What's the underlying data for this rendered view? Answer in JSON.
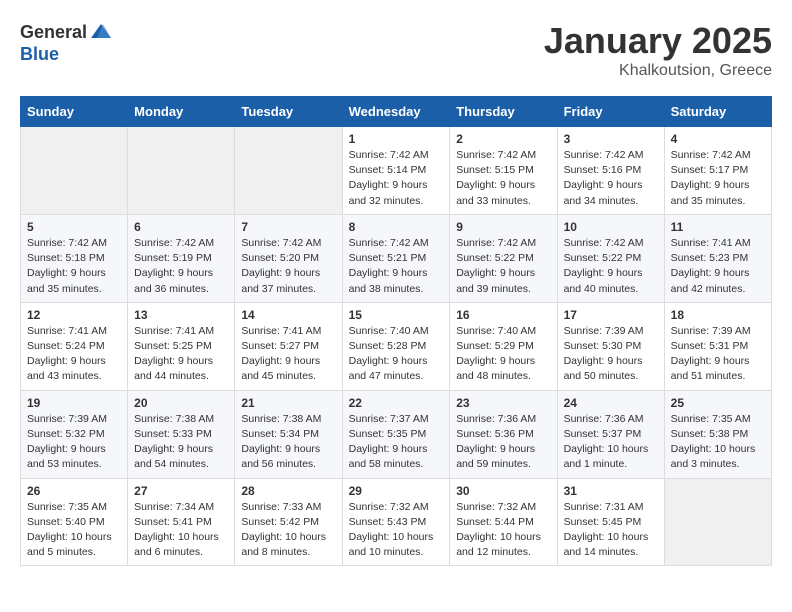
{
  "header": {
    "logo_general": "General",
    "logo_blue": "Blue",
    "month": "January 2025",
    "location": "Khalkoutsion, Greece"
  },
  "weekdays": [
    "Sunday",
    "Monday",
    "Tuesday",
    "Wednesday",
    "Thursday",
    "Friday",
    "Saturday"
  ],
  "weeks": [
    [
      {
        "day": "",
        "info": ""
      },
      {
        "day": "",
        "info": ""
      },
      {
        "day": "",
        "info": ""
      },
      {
        "day": "1",
        "info": "Sunrise: 7:42 AM\nSunset: 5:14 PM\nDaylight: 9 hours and 32 minutes."
      },
      {
        "day": "2",
        "info": "Sunrise: 7:42 AM\nSunset: 5:15 PM\nDaylight: 9 hours and 33 minutes."
      },
      {
        "day": "3",
        "info": "Sunrise: 7:42 AM\nSunset: 5:16 PM\nDaylight: 9 hours and 34 minutes."
      },
      {
        "day": "4",
        "info": "Sunrise: 7:42 AM\nSunset: 5:17 PM\nDaylight: 9 hours and 35 minutes."
      }
    ],
    [
      {
        "day": "5",
        "info": "Sunrise: 7:42 AM\nSunset: 5:18 PM\nDaylight: 9 hours and 35 minutes."
      },
      {
        "day": "6",
        "info": "Sunrise: 7:42 AM\nSunset: 5:19 PM\nDaylight: 9 hours and 36 minutes."
      },
      {
        "day": "7",
        "info": "Sunrise: 7:42 AM\nSunset: 5:20 PM\nDaylight: 9 hours and 37 minutes."
      },
      {
        "day": "8",
        "info": "Sunrise: 7:42 AM\nSunset: 5:21 PM\nDaylight: 9 hours and 38 minutes."
      },
      {
        "day": "9",
        "info": "Sunrise: 7:42 AM\nSunset: 5:22 PM\nDaylight: 9 hours and 39 minutes."
      },
      {
        "day": "10",
        "info": "Sunrise: 7:42 AM\nSunset: 5:22 PM\nDaylight: 9 hours and 40 minutes."
      },
      {
        "day": "11",
        "info": "Sunrise: 7:41 AM\nSunset: 5:23 PM\nDaylight: 9 hours and 42 minutes."
      }
    ],
    [
      {
        "day": "12",
        "info": "Sunrise: 7:41 AM\nSunset: 5:24 PM\nDaylight: 9 hours and 43 minutes."
      },
      {
        "day": "13",
        "info": "Sunrise: 7:41 AM\nSunset: 5:25 PM\nDaylight: 9 hours and 44 minutes."
      },
      {
        "day": "14",
        "info": "Sunrise: 7:41 AM\nSunset: 5:27 PM\nDaylight: 9 hours and 45 minutes."
      },
      {
        "day": "15",
        "info": "Sunrise: 7:40 AM\nSunset: 5:28 PM\nDaylight: 9 hours and 47 minutes."
      },
      {
        "day": "16",
        "info": "Sunrise: 7:40 AM\nSunset: 5:29 PM\nDaylight: 9 hours and 48 minutes."
      },
      {
        "day": "17",
        "info": "Sunrise: 7:39 AM\nSunset: 5:30 PM\nDaylight: 9 hours and 50 minutes."
      },
      {
        "day": "18",
        "info": "Sunrise: 7:39 AM\nSunset: 5:31 PM\nDaylight: 9 hours and 51 minutes."
      }
    ],
    [
      {
        "day": "19",
        "info": "Sunrise: 7:39 AM\nSunset: 5:32 PM\nDaylight: 9 hours and 53 minutes."
      },
      {
        "day": "20",
        "info": "Sunrise: 7:38 AM\nSunset: 5:33 PM\nDaylight: 9 hours and 54 minutes."
      },
      {
        "day": "21",
        "info": "Sunrise: 7:38 AM\nSunset: 5:34 PM\nDaylight: 9 hours and 56 minutes."
      },
      {
        "day": "22",
        "info": "Sunrise: 7:37 AM\nSunset: 5:35 PM\nDaylight: 9 hours and 58 minutes."
      },
      {
        "day": "23",
        "info": "Sunrise: 7:36 AM\nSunset: 5:36 PM\nDaylight: 9 hours and 59 minutes."
      },
      {
        "day": "24",
        "info": "Sunrise: 7:36 AM\nSunset: 5:37 PM\nDaylight: 10 hours and 1 minute."
      },
      {
        "day": "25",
        "info": "Sunrise: 7:35 AM\nSunset: 5:38 PM\nDaylight: 10 hours and 3 minutes."
      }
    ],
    [
      {
        "day": "26",
        "info": "Sunrise: 7:35 AM\nSunset: 5:40 PM\nDaylight: 10 hours and 5 minutes."
      },
      {
        "day": "27",
        "info": "Sunrise: 7:34 AM\nSunset: 5:41 PM\nDaylight: 10 hours and 6 minutes."
      },
      {
        "day": "28",
        "info": "Sunrise: 7:33 AM\nSunset: 5:42 PM\nDaylight: 10 hours and 8 minutes."
      },
      {
        "day": "29",
        "info": "Sunrise: 7:32 AM\nSunset: 5:43 PM\nDaylight: 10 hours and 10 minutes."
      },
      {
        "day": "30",
        "info": "Sunrise: 7:32 AM\nSunset: 5:44 PM\nDaylight: 10 hours and 12 minutes."
      },
      {
        "day": "31",
        "info": "Sunrise: 7:31 AM\nSunset: 5:45 PM\nDaylight: 10 hours and 14 minutes."
      },
      {
        "day": "",
        "info": ""
      }
    ]
  ]
}
